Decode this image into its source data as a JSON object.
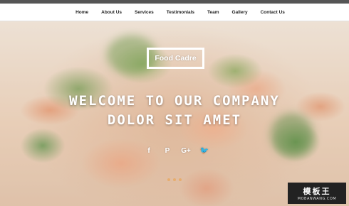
{
  "nav": {
    "items": [
      {
        "label": "Home"
      },
      {
        "label": "About Us"
      },
      {
        "label": "Services"
      },
      {
        "label": "Testimonials"
      },
      {
        "label": "Team"
      },
      {
        "label": "Gallery"
      },
      {
        "label": "Contact Us"
      }
    ]
  },
  "hero": {
    "logo_text": "Food Cadre",
    "headline_1": "WELCOME TO OUR COMPANY",
    "headline_2": "DOLOR SIT AMET",
    "social": [
      {
        "icon": "facebook-icon",
        "glyph": "f"
      },
      {
        "icon": "pinterest-icon",
        "glyph": "P"
      },
      {
        "icon": "google-plus-icon",
        "glyph": "G+"
      },
      {
        "icon": "twitter-icon",
        "glyph": "🐦"
      }
    ],
    "slides": 3,
    "active_slide": 1
  },
  "watermark": {
    "cn": "模板王",
    "en": "MOBANWANG.COM"
  },
  "colors": {
    "accent_dot": "#e7ad6e",
    "nav_text": "#222222",
    "overlay_text": "#ffffff"
  }
}
